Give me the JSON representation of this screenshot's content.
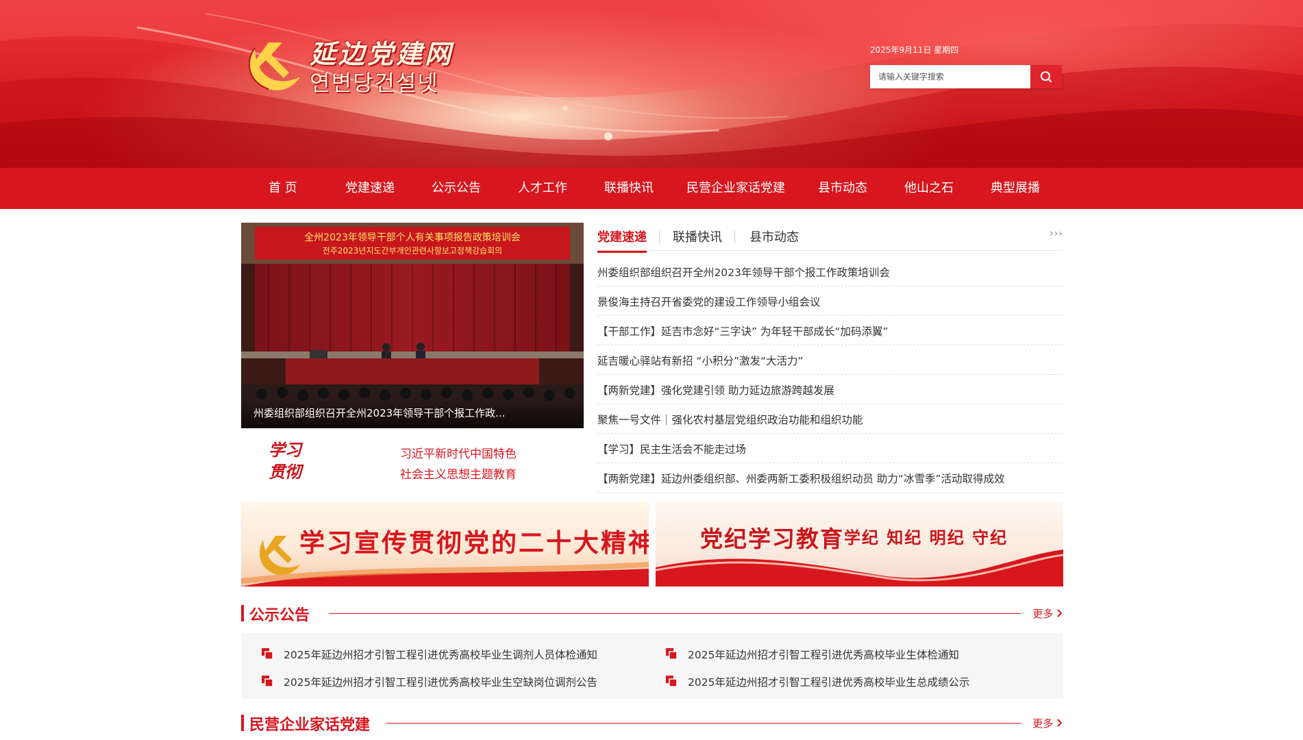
{
  "site": {
    "title_cn": "延边党建网",
    "title_kr": "연변당건설넷",
    "date": "2025年9月11日 星期四"
  },
  "search": {
    "placeholder": "请输入关键字搜索"
  },
  "nav": {
    "items": [
      "首 页",
      "党建速递",
      "公示公告",
      "人才工作",
      "联播快讯",
      "民营企业家话党建",
      "县市动态",
      "他山之石",
      "典型展播"
    ]
  },
  "slider": {
    "banner_line1": "全州2023年领导干部个人有关事项报告政策培训会",
    "banner_line2": "전주2023년지도간부개인관련사항보고정책강습회의",
    "caption": "州委组织部组织召开全州2023年领导干部个报工作政..."
  },
  "study": {
    "calli_1": "学习",
    "calli_2": "贯彻",
    "line1": "习近平新时代中国特色",
    "line2": "社会主义思想主题教育"
  },
  "news": {
    "tabs": [
      "党建速递",
      "联播快讯",
      "县市动态"
    ],
    "more": "›››",
    "items": [
      "州委组织部组织召开全州2023年领导干部个报工作政策培训会",
      "景俊海主持召开省委党的建设工作领导小组会议",
      "【干部工作】延吉市念好“三字诀” 为年轻干部成长“加码添翼”",
      "延吉暖心驿站有新招 “小积分”激发“大活力”",
      "【两新党建】强化党建引领 助力延边旅游跨越发展",
      "聚焦一号文件｜强化农村基层党组织政治功能和组织功能",
      "【学习】民主生活会不能走过场",
      "【两新党建】延边州委组织部、州委两新工委积极组织动员 助力“冰雪季”活动取得成效"
    ]
  },
  "banners": {
    "left_text": "学习宣传贯彻党的二十大精神",
    "right_text1": "党纪学习教育",
    "right_text2": "学纪 知纪 明纪 守纪"
  },
  "notices": {
    "title": "公示公告",
    "more": "更多",
    "items": [
      "2025年延边州招才引智工程引进优秀高校毕业生调剂人员体检通知",
      "2025年延边州招才引智工程引进优秀高校毕业生体检通知",
      "2025年延边州招才引智工程引进优秀高校毕业生空缺岗位调剂公告",
      "2025年延边州招才引智工程引进优秀高校毕业生总成绩公示"
    ]
  },
  "private_section": {
    "title": "民营企业家话党建",
    "more": "更多"
  },
  "icons": [
    "party-emblem-icon",
    "search-icon",
    "document-icon",
    "chevron-right-icon"
  ],
  "colors": {
    "primary_red": "#d7161e",
    "header_red": "#e8383b",
    "text": "#333333"
  }
}
